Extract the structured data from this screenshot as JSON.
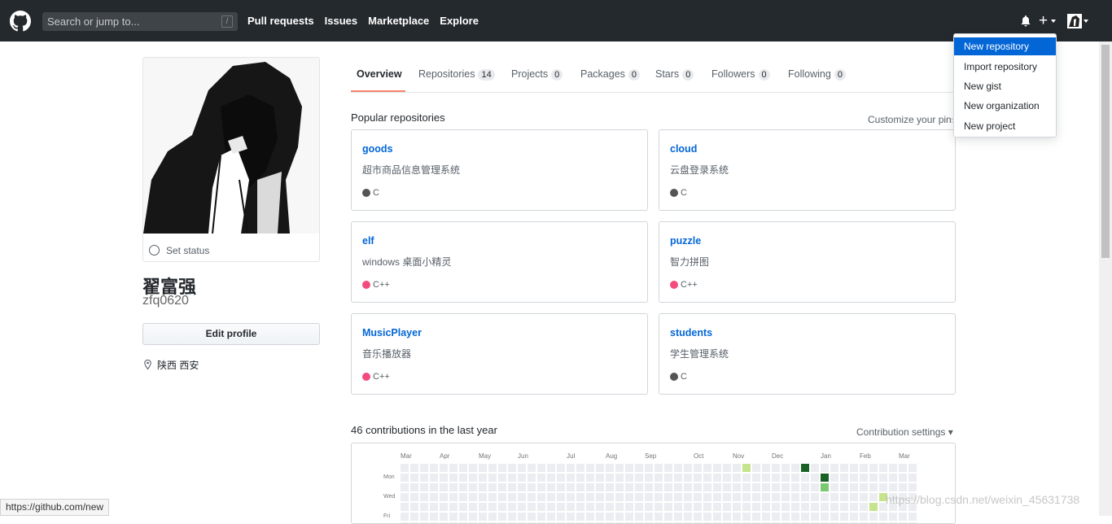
{
  "header": {
    "search_placeholder": "Search or jump to...",
    "search_shortcut": "/",
    "nav": [
      "Pull requests",
      "Issues",
      "Marketplace",
      "Explore"
    ],
    "plus_symbol": "+"
  },
  "profile": {
    "set_status": "Set status",
    "fullname": "翟富强",
    "username": "zfq0620",
    "edit_profile": "Edit profile",
    "location": "陕西 西安"
  },
  "tabs": [
    {
      "label": "Overview",
      "count": ""
    },
    {
      "label": "Repositories",
      "count": "14"
    },
    {
      "label": "Projects",
      "count": "0"
    },
    {
      "label": "Packages",
      "count": "0"
    },
    {
      "label": "Stars",
      "count": "0"
    },
    {
      "label": "Followers",
      "count": "0"
    },
    {
      "label": "Following",
      "count": "0"
    }
  ],
  "popular": {
    "title": "Popular repositories",
    "customize": "Customize your pins"
  },
  "repos": [
    {
      "name": "goods",
      "desc": "超市商品信息管理系统",
      "lang": "C",
      "color": "#555555"
    },
    {
      "name": "cloud",
      "desc": "云盘登录系统",
      "lang": "C",
      "color": "#555555"
    },
    {
      "name": "elf",
      "desc": "windows 桌面小精灵",
      "lang": "C++",
      "color": "#f34b7d"
    },
    {
      "name": "puzzle",
      "desc": "智力拼图",
      "lang": "C++",
      "color": "#f34b7d"
    },
    {
      "name": "MusicPlayer",
      "desc": "音乐播放器",
      "lang": "C++",
      "color": "#f34b7d"
    },
    {
      "name": "students",
      "desc": "学生管理系统",
      "lang": "C",
      "color": "#555555"
    }
  ],
  "contributions": {
    "title": "46 contributions in the last year",
    "settings": "Contribution settings",
    "months": [
      "Mar",
      "Apr",
      "May",
      "Jun",
      "Jul",
      "Aug",
      "Sep",
      "Oct",
      "Nov",
      "Dec",
      "Jan",
      "Feb",
      "Mar"
    ],
    "days": [
      "Mon",
      "Wed",
      "Fri"
    ]
  },
  "dropdown": {
    "items": [
      "New repository",
      "Import repository",
      "New gist",
      "New organization",
      "New project"
    ]
  },
  "statusbar_url": "https://github.com/new",
  "watermark": "https://blog.csdn.net/weixin_45631738"
}
